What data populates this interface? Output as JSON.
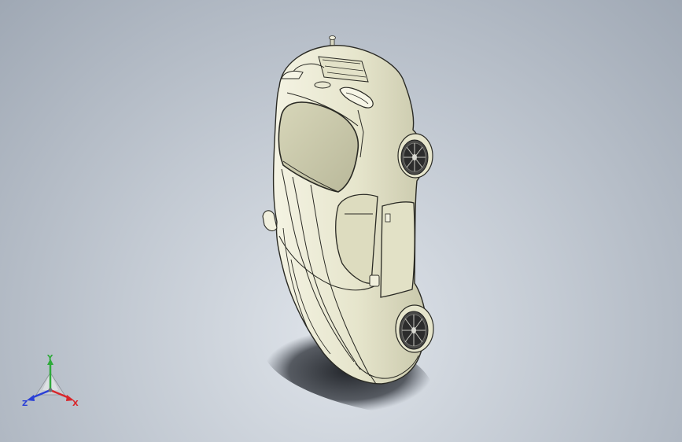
{
  "viewport": {
    "background_top": "#9fa8b4",
    "background_bottom": "#dfe4ea"
  },
  "model": {
    "kind": "sports-car",
    "view": "isometric-top",
    "body_color": "#e9e8d2",
    "line_color": "#2a2a24",
    "wheel_color": "#3b3b3b"
  },
  "triad": {
    "x_label": "X",
    "y_label": "Y",
    "z_label": "Z",
    "x_color": "#d8262b",
    "y_color": "#2eaa3a",
    "z_color": "#2a3fd6"
  }
}
